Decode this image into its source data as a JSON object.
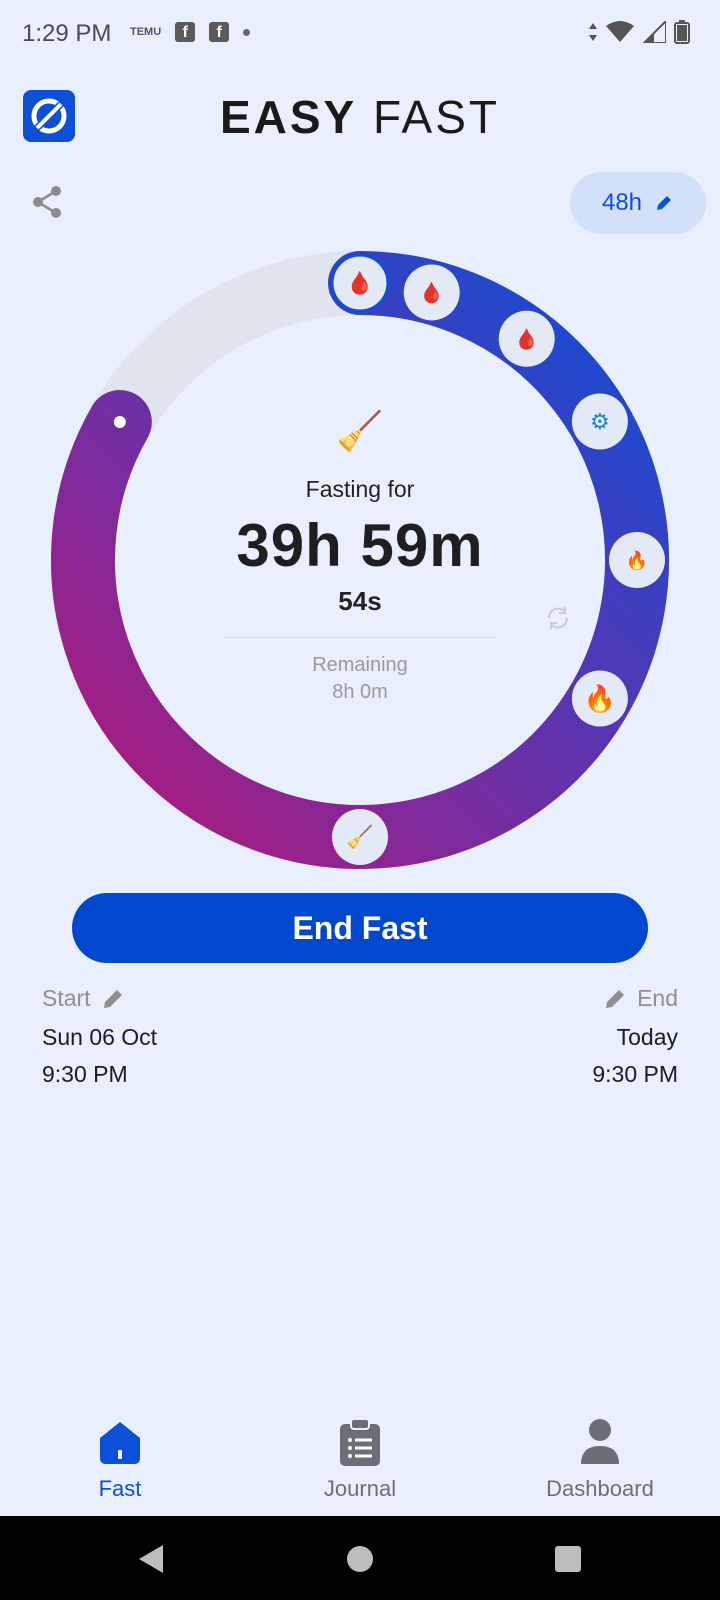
{
  "status_bar": {
    "time": "1:29 PM",
    "temu_label": "TEMU",
    "notification_icons": [
      "temu-icon",
      "facebook-icon",
      "facebook-icon",
      "dot-icon"
    ],
    "system_icons": [
      "data-arrows-icon",
      "wifi-icon",
      "signal-icon",
      "battery-icon"
    ]
  },
  "header": {
    "title_bold": "EASY",
    "title_light": "FAST"
  },
  "target": {
    "label": "48h"
  },
  "timer": {
    "fasting_label": "Fasting for",
    "elapsed": "39h 59m",
    "seconds": "54s",
    "remaining_label": "Remaining",
    "remaining_value": "8h 0m",
    "progress_fraction": 0.833
  },
  "ring_stages": [
    "blood-sugar-rising-icon",
    "blood-sugar-falling-icon",
    "blood-sugar-normal-icon",
    "gear-energy-icon",
    "fire-small-icon",
    "fire-large-icon",
    "broom-icon"
  ],
  "actions": {
    "end_fast": "End Fast"
  },
  "start": {
    "label": "Start",
    "date": "Sun 06 Oct",
    "time": "9:30 PM"
  },
  "end": {
    "label": "End",
    "date": "Today",
    "time": "9:30 PM"
  },
  "nav": {
    "items": [
      {
        "label": "Fast",
        "icon": "home-icon",
        "active": true
      },
      {
        "label": "Journal",
        "icon": "clipboard-icon",
        "active": false
      },
      {
        "label": "Dashboard",
        "icon": "person-icon",
        "active": false
      }
    ]
  },
  "colors": {
    "primary": "#0049cf",
    "ring_start": "#b3197a",
    "ring_end": "#0d4fd6",
    "background": "#e9effc"
  }
}
